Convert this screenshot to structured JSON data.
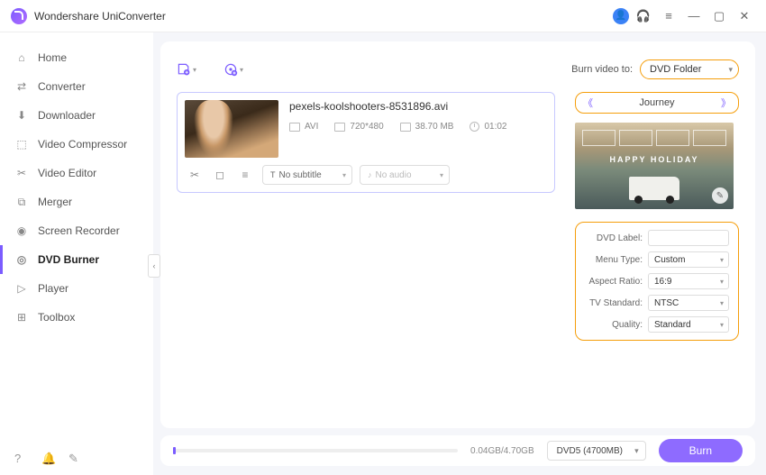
{
  "app": {
    "title": "Wondershare UniConverter"
  },
  "sidebar": {
    "items": [
      {
        "label": "Home"
      },
      {
        "label": "Converter"
      },
      {
        "label": "Downloader"
      },
      {
        "label": "Video Compressor"
      },
      {
        "label": "Video Editor"
      },
      {
        "label": "Merger"
      },
      {
        "label": "Screen Recorder"
      },
      {
        "label": "DVD Burner"
      },
      {
        "label": "Player"
      },
      {
        "label": "Toolbox"
      }
    ]
  },
  "toolbar": {
    "burn_to_label": "Burn video to:",
    "burn_to_value": "DVD Folder"
  },
  "file": {
    "name": "pexels-koolshooters-8531896.avi",
    "format": "AVI",
    "resolution": "720*480",
    "size": "38.70 MB",
    "duration": "01:02",
    "subtitle": "No subtitle",
    "audio": "No audio"
  },
  "template": {
    "name": "Journey",
    "preview_text": "HAPPY HOLIDAY"
  },
  "settings": {
    "dvd_label_label": "DVD Label:",
    "dvd_label_value": "",
    "menu_type_label": "Menu Type:",
    "menu_type_value": "Custom",
    "aspect_ratio_label": "Aspect Ratio:",
    "aspect_ratio_value": "16:9",
    "tv_standard_label": "TV Standard:",
    "tv_standard_value": "NTSC",
    "quality_label": "Quality:",
    "quality_value": "Standard"
  },
  "bottom": {
    "size_text": "0.04GB/4.70GB",
    "disc_value": "DVD5 (4700MB)",
    "burn_label": "Burn"
  }
}
